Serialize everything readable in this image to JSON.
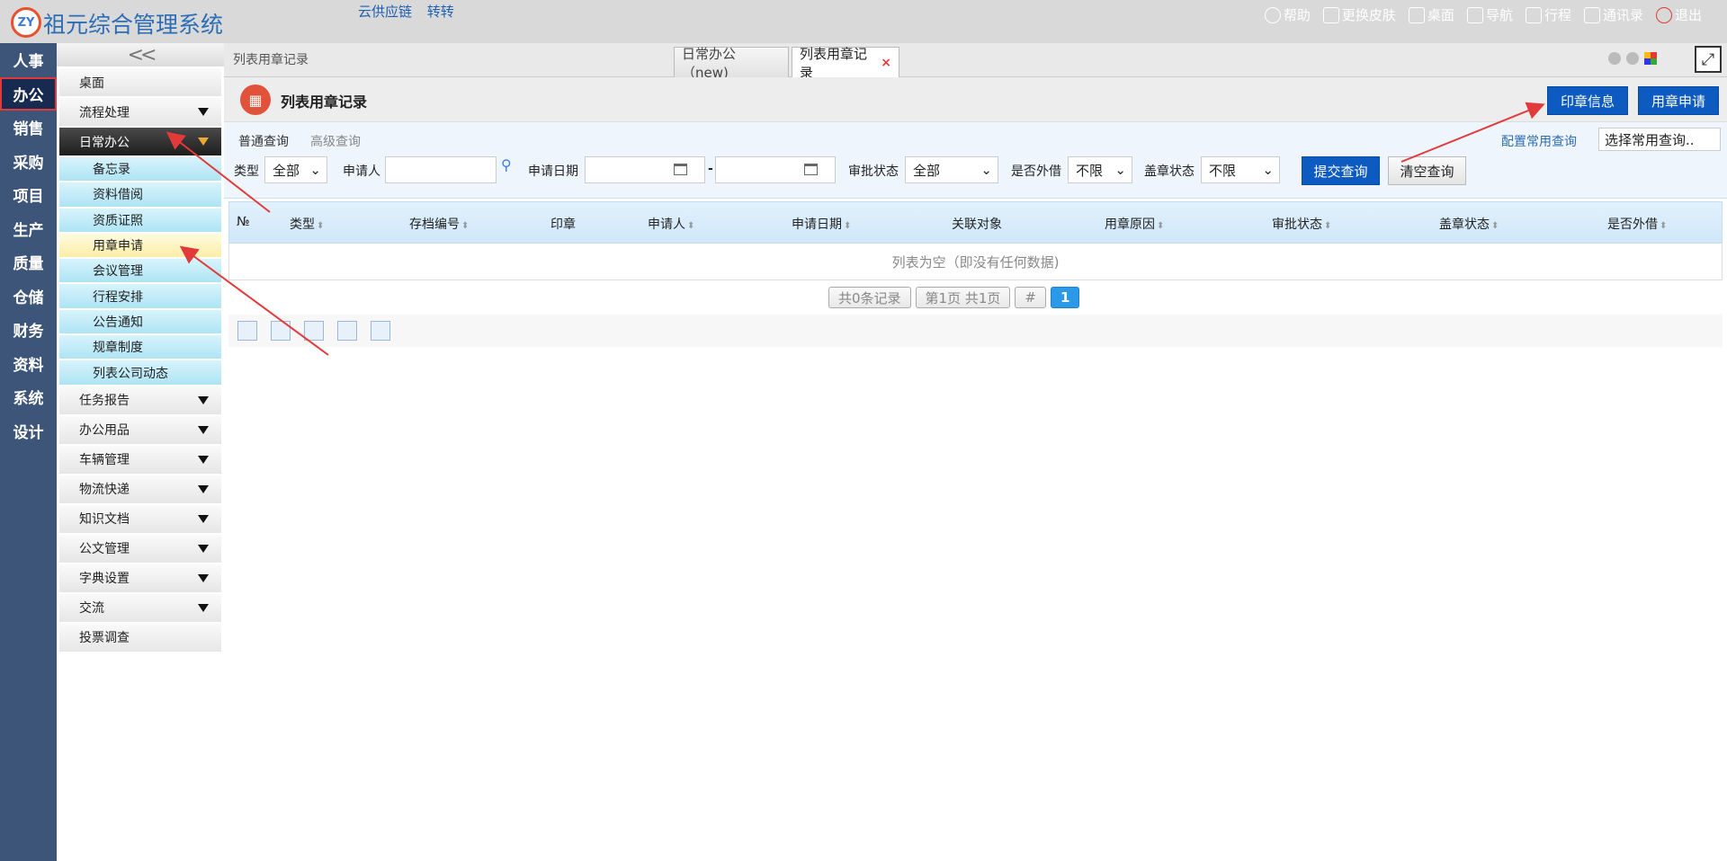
{
  "app": {
    "logo_text": "ZY",
    "title": "祖元综合管理系统",
    "top_links": [
      "云供应链",
      "转转"
    ]
  },
  "topbar_right": [
    {
      "label": "帮助",
      "icon": "help-icon"
    },
    {
      "label": "更换皮肤",
      "icon": "shirt-icon"
    },
    {
      "label": "桌面",
      "icon": "home-icon"
    },
    {
      "label": "导航",
      "icon": "grid-icon"
    },
    {
      "label": "行程",
      "icon": "calendar-icon"
    },
    {
      "label": "通讯录",
      "icon": "contacts-icon"
    },
    {
      "label": "退出",
      "icon": "power-icon"
    }
  ],
  "leftnav": [
    "人事",
    "办公",
    "销售",
    "采购",
    "项目",
    "生产",
    "质量",
    "仓储",
    "财务",
    "资料",
    "系统",
    "设计"
  ],
  "leftnav_active": "办公",
  "sidebar": {
    "collapse_label": "<<",
    "desktop": "桌面",
    "flow": "流程处理",
    "daily": "日常办公",
    "daily_items": [
      "备忘录",
      "资料借阅",
      "资质证照",
      "用章申请",
      "会议管理",
      "行程安排",
      "公告通知",
      "规章制度",
      "列表公司动态"
    ],
    "highlighted": "用章申请",
    "groups": [
      "任务报告",
      "办公用品",
      "车辆管理",
      "物流快递",
      "知识文档",
      "公文管理",
      "字典设置",
      "交流"
    ],
    "vote": "投票调查"
  },
  "breadcrumb": "列表用章记录",
  "tabs": [
    {
      "label": "日常办公（new)",
      "active": false
    },
    {
      "label": "列表用章记录",
      "active": true,
      "close": "×"
    }
  ],
  "expand_icon": "⤢",
  "page": {
    "title": "列表用章记录",
    "btn_seal_info": "印章信息",
    "btn_seal_apply": "用章申请"
  },
  "search": {
    "mode_normal": "普通查询",
    "mode_advanced": "高级查询",
    "config_link": "配置常用查询",
    "config_select": "选择常用查询..",
    "type_label": "类型",
    "type_value": "全部",
    "applicant_label": "申请人",
    "date_label": "申请日期",
    "date_sep": "-",
    "approval_label": "审批状态",
    "approval_value": "全部",
    "external_label": "是否外借",
    "external_value": "不限",
    "stamp_label": "盖章状态",
    "stamp_value": "不限",
    "submit": "提交查询",
    "clear": "清空查询"
  },
  "table": {
    "columns": [
      "№",
      "类型",
      "存档编号",
      "印章",
      "申请人",
      "申请日期",
      "关联对象",
      "用章原因",
      "审批状态",
      "盖章状态",
      "是否外借"
    ],
    "empty": "列表为空（即没有任何数据)"
  },
  "pager": {
    "total": "共0条记录",
    "page": "第1页 共1页",
    "hash": "#",
    "current": "1"
  },
  "colors": {
    "accent_blue": "#0d5bc0",
    "nav_bg": "#3d5579",
    "annotation_red": "#e23a3a"
  }
}
